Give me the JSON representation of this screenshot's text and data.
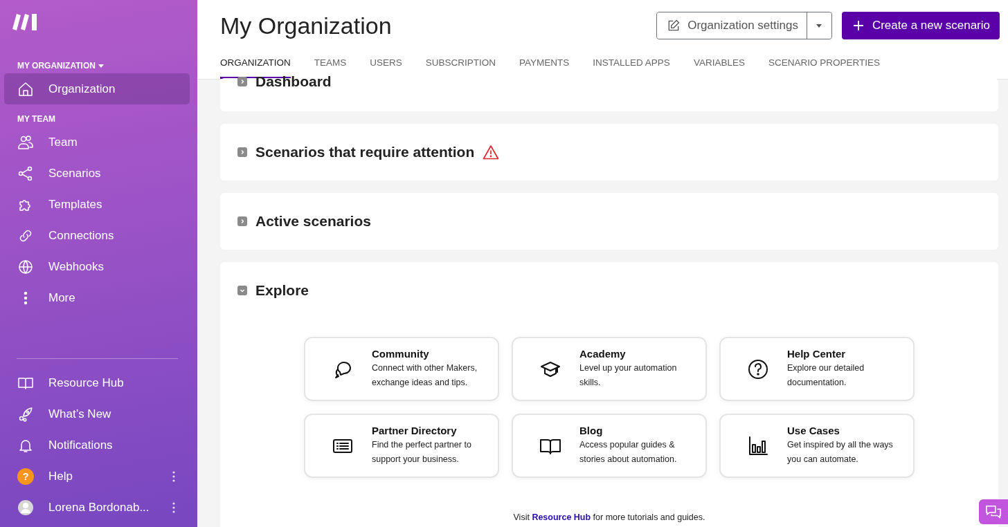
{
  "sidebar": {
    "org_heading": "MY ORGANIZATION",
    "org_items": [
      {
        "label": "Organization",
        "kind": "home",
        "selected": true
      }
    ],
    "team_heading": "MY TEAM",
    "team_items": [
      {
        "label": "Team",
        "kind": "users",
        "selected": false
      },
      {
        "label": "Scenarios",
        "kind": "share",
        "selected": false
      },
      {
        "label": "Templates",
        "kind": "puzzle",
        "selected": false
      },
      {
        "label": "Connections",
        "kind": "link",
        "selected": false
      },
      {
        "label": "Webhooks",
        "kind": "globe",
        "selected": false
      },
      {
        "label": "More",
        "kind": "dots",
        "selected": false
      }
    ],
    "bottom_items": [
      {
        "label": "Resource Hub",
        "kind": "book",
        "menu": false
      },
      {
        "label": "What’s New",
        "kind": "rocket",
        "menu": false
      },
      {
        "label": "Notifications",
        "kind": "bell",
        "menu": false
      },
      {
        "label": "Help",
        "kind": "help",
        "badge": "?",
        "menu": true
      },
      {
        "label": "Lorena Bordonab...",
        "kind": "avatar",
        "menu": true
      }
    ]
  },
  "header": {
    "title": "My Organization",
    "settings_button": "Organization settings",
    "create_button": "Create a new scenario"
  },
  "tabs": [
    {
      "label": "ORGANIZATION",
      "selected": true
    },
    {
      "label": "TEAMS",
      "selected": false
    },
    {
      "label": "USERS",
      "selected": false
    },
    {
      "label": "SUBSCRIPTION",
      "selected": false
    },
    {
      "label": "PAYMENTS",
      "selected": false
    },
    {
      "label": "INSTALLED APPS",
      "selected": false
    },
    {
      "label": "VARIABLES",
      "selected": false
    },
    {
      "label": "SCENARIO PROPERTIES",
      "selected": false
    }
  ],
  "sections": [
    {
      "title": "Dashboard",
      "expanded": false,
      "warning": false
    },
    {
      "title": "Scenarios that require attention",
      "expanded": false,
      "warning": true
    },
    {
      "title": "Active scenarios",
      "expanded": false,
      "warning": false
    },
    {
      "title": "Explore",
      "expanded": true,
      "warning": false,
      "cards": [
        {
          "title": "Community",
          "text": "Connect with other Makers, exchange ideas and tips.",
          "kind": "chat"
        },
        {
          "title": "Academy",
          "text": "Level up your automation skills.",
          "kind": "cap"
        },
        {
          "title": "Help Center",
          "text": "Explore our detailed documentation.",
          "kind": "question"
        },
        {
          "title": "Partner Directory",
          "text": "Find the perfect partner to support your business.",
          "kind": "list"
        },
        {
          "title": "Blog",
          "text": "Access popular guides & stories about automation.",
          "kind": "book"
        },
        {
          "title": "Use Cases",
          "text": "Get inspired by all the ways you can automate.",
          "kind": "chart"
        }
      ],
      "footer": {
        "before": "Visit",
        "link": "Resource Hub",
        "after": "for more tutorials and guides."
      }
    }
  ]
}
